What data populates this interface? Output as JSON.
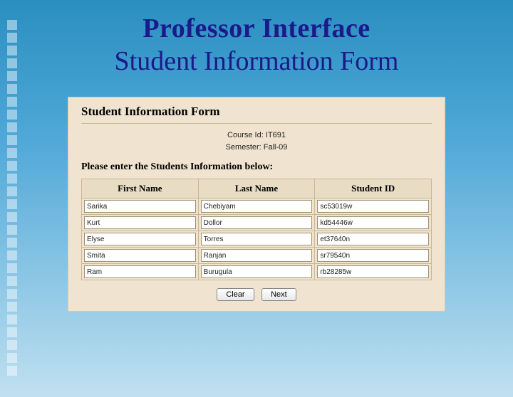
{
  "slide": {
    "title_line1": "Professor Interface",
    "title_line2": "Student Information Form"
  },
  "form": {
    "panel_title": "Student Information Form",
    "course_label": "Course Id:",
    "course_value": "IT691",
    "semester_label": "Semester:",
    "semester_value": "Fall-09",
    "instruction": "Please enter the Students Information below:",
    "columns": {
      "first_name": "First Name",
      "last_name": "Last Name",
      "student_id": "Student ID"
    },
    "rows": [
      {
        "first": "Sarika",
        "last": "Chebiyam",
        "id": "sc53019w"
      },
      {
        "first": "Kurt",
        "last": "Dollor",
        "id": "kd54446w"
      },
      {
        "first": "Elyse",
        "last": "Torres",
        "id": "et37640n"
      },
      {
        "first": "Smita",
        "last": "Ranjan",
        "id": "sr79540n"
      },
      {
        "first": "Ram",
        "last": "Burugula",
        "id": "rb28285w"
      }
    ],
    "buttons": {
      "clear": "Clear",
      "next": "Next"
    }
  }
}
